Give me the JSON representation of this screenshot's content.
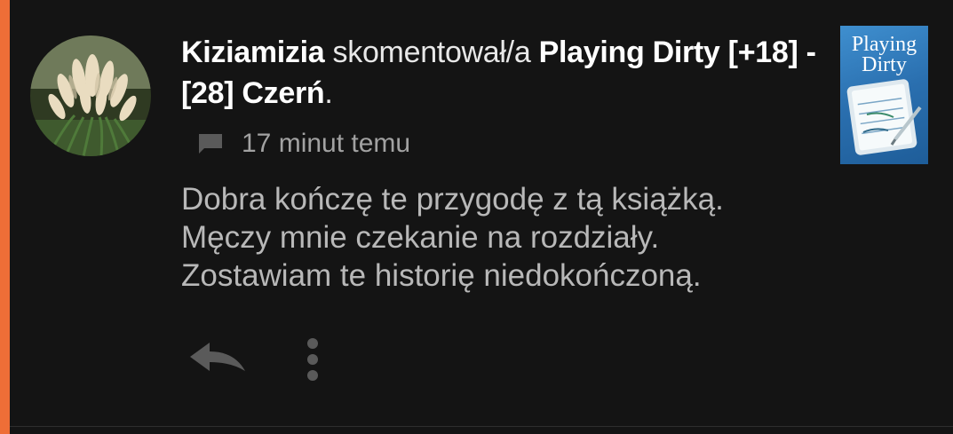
{
  "notification": {
    "user_name": "Kiziamizia",
    "action_text": "skomentował/a",
    "story_title": "Playing Dirty [+18] - [28] Czerń",
    "title_suffix": ".",
    "time_ago": "17 minut temu",
    "comment_lines": [
      "Dobra kończę te przygodę z tą książką.",
      "Męczy mnie czekanie na rozdziały.",
      "Zostawiam te historię niedokończoną."
    ]
  },
  "book_cover": {
    "title_line1": "Playing",
    "title_line2": "Dirty"
  },
  "icons": {
    "comment": "comment-bubble-icon",
    "reply": "reply-arrow-icon",
    "more": "more-vertical-icon"
  },
  "colors": {
    "accent": "#ee6e37",
    "background": "#141414",
    "primary_text": "#ffffff",
    "secondary_text": "#a2a2a2",
    "comment_text": "#b8b8b8",
    "cover_blue": "#2a6faf"
  }
}
